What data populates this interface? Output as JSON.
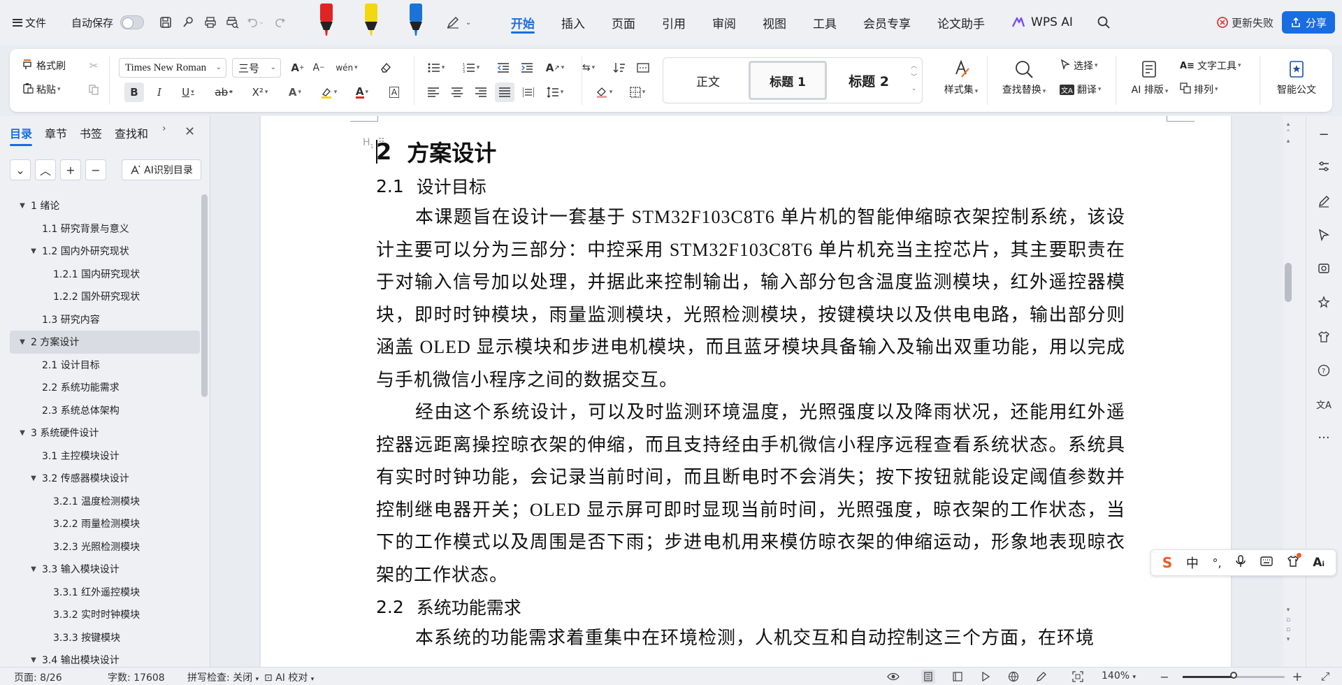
{
  "menubar": {
    "file": "文件",
    "autosave": "自动保存",
    "tabs": [
      "开始",
      "插入",
      "页面",
      "引用",
      "审阅",
      "视图",
      "工具",
      "会员专享",
      "论文助手"
    ],
    "wps_ai": "WPS AI",
    "update": "更新失败",
    "share": "分享",
    "marker_colors": [
      "#e02424",
      "#f2d80c",
      "#1a73d6"
    ]
  },
  "ribbon": {
    "format_painter": "格式刷",
    "paste": "粘贴",
    "font_name": "Times New Roman",
    "font_size": "三号",
    "styles": [
      "正文",
      "标题 1",
      "标题 2"
    ],
    "style_set": "样式集",
    "find_replace": "查找替换",
    "select": "选择",
    "translate": "翻译",
    "text_tools": "文字工具",
    "ai_layout": "AI 排版",
    "arrange": "排列",
    "smart_doc": "智能公文",
    "bold": "B",
    "italic": "I",
    "underline": "U",
    "strike": "ab",
    "superscript": "X²"
  },
  "sidebar": {
    "tabs": [
      "目录",
      "章节",
      "书签",
      "查找和"
    ],
    "ai_toc": "AI识别目录",
    "toc": [
      {
        "text": "1  绪论",
        "level": 1,
        "expand": true
      },
      {
        "text": "1.1  研究背景与意义",
        "level": 2,
        "expand": false
      },
      {
        "text": "1.2  国内外研究现状",
        "level": 2,
        "expand": true
      },
      {
        "text": "1.2.1  国内研究现状",
        "level": 3,
        "expand": false
      },
      {
        "text": "1.2.2  国外研究现状",
        "level": 3,
        "expand": false
      },
      {
        "text": "1.3  研究内容",
        "level": 2,
        "expand": false
      },
      {
        "text": "2  方案设计",
        "level": 1,
        "expand": true,
        "active": true
      },
      {
        "text": "2.1  设计目标",
        "level": 2,
        "expand": false
      },
      {
        "text": "2.2  系统功能需求",
        "level": 2,
        "expand": false
      },
      {
        "text": "2.3  系统总体架构",
        "level": 2,
        "expand": false
      },
      {
        "text": "3  系统硬件设计",
        "level": 1,
        "expand": true
      },
      {
        "text": "3.1  主控模块设计",
        "level": 2,
        "expand": false
      },
      {
        "text": "3.2  传感器模块设计",
        "level": 2,
        "expand": true
      },
      {
        "text": "3.2.1  温度检测模块",
        "level": 3,
        "expand": false
      },
      {
        "text": "3.2.2  雨量检测模块",
        "level": 3,
        "expand": false
      },
      {
        "text": "3.2.3  光照检测模块",
        "level": 3,
        "expand": false
      },
      {
        "text": "3.3  输入模块设计",
        "level": 2,
        "expand": true
      },
      {
        "text": "3.3.1  红外遥控模块",
        "level": 3,
        "expand": false
      },
      {
        "text": "3.3.2  实时时钟模块",
        "level": 3,
        "expand": false
      },
      {
        "text": "3.3.3  按键模块",
        "level": 3,
        "expand": false
      },
      {
        "text": "3.4  输出模块设计",
        "level": 2,
        "expand": true
      }
    ]
  },
  "document": {
    "h1_num": "2",
    "h1_text": "方案设计",
    "h2a_num": "2.1",
    "h2a_text": "设计目标",
    "para1": "本课题旨在设计一套基于 STM32F103C8T6 单片机的智能伸缩晾衣架控制系统，该设计主要可以分为三部分：中控采用 STM32F103C8T6 单片机充当主控芯片，其主要职责在于对输入信号加以处理，并据此来控制输出，输入部分包含温度监测模块，红外遥控器模块，即时时钟模块，雨量监测模块，光照检测模块，按键模块以及供电电路，输出部分则涵盖 OLED 显示模块和步进电机模块，而且蓝牙模块具备输入及输出双重功能，用以完成与手机微信小程序之间的数据交互。",
    "para2": "经由这个系统设计，可以及时监测环境温度，光照强度以及降雨状况，还能用红外遥控器远距离操控晾衣架的伸缩，而且支持经由手机微信小程序远程查看系统状态。系统具有实时时钟功能，会记录当前时间，而且断电时不会消失；按下按钮就能设定阈值参数并控制继电器开关；OLED 显示屏可即时显现当前时间，光照强度，晾衣架的工作状态，当下的工作模式以及周围是否下雨；步进电机用来模仿晾衣架的伸缩运动，形象地表现晾衣架的工作状态。",
    "h2b_num": "2.2",
    "h2b_text": "系统功能需求",
    "para3": "本系统的功能需求着重集中在环境检测，人机交互和自动控制这三个方面，在环境"
  },
  "ime": {
    "lang": "中"
  },
  "statusbar": {
    "page": "页面: 8/26",
    "words": "字数: 17608",
    "spell": "拼写检查: 关闭",
    "ai_check": "AI 校对",
    "zoom": "140%",
    "zoom_level": 0.5
  }
}
